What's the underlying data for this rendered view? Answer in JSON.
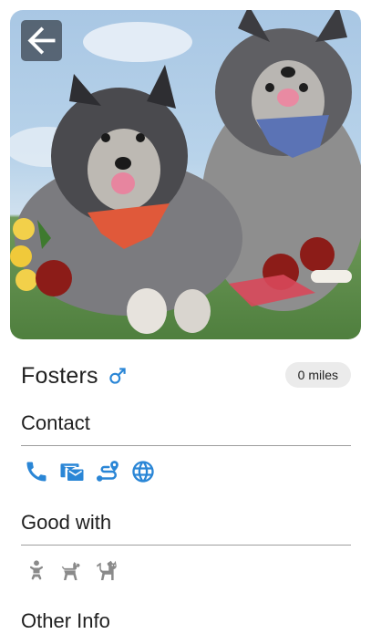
{
  "pet": {
    "name": "Fosters",
    "gender_icon": "male-icon",
    "distance": "0 miles",
    "photo_icon": "pet-photo"
  },
  "navigation": {
    "back_icon": "arrow-left-icon"
  },
  "sections": {
    "contact": "Contact",
    "good_with": "Good with",
    "other_info": "Other Info"
  },
  "contact_icons": [
    "phone-icon",
    "email-icon",
    "directions-icon",
    "website-icon"
  ],
  "good_with_icons": [
    "child-icon",
    "dog-icon",
    "cat-icon"
  ],
  "colors": {
    "accent": "#2a86d6",
    "icon_grey": "#8a8a8a",
    "chip_bg": "#ebebeb"
  }
}
